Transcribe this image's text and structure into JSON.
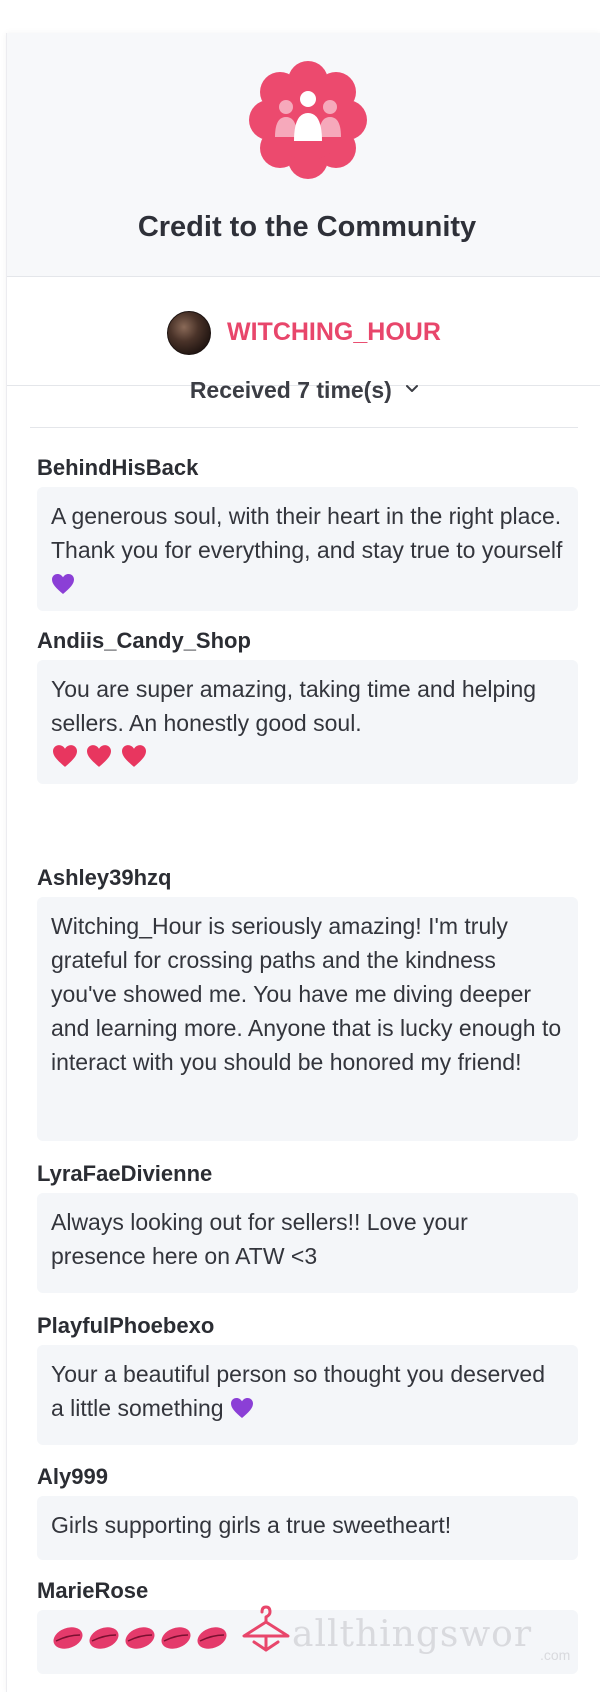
{
  "header": {
    "title": "Credit to the Community",
    "icon": "community-badge-icon",
    "accent_color": "#e8466b"
  },
  "recipient": {
    "username": "WITCHING_HOUR"
  },
  "received": {
    "label": "Received 7 time(s)"
  },
  "entries": [
    {
      "name": "BehindHisBack",
      "message": "A generous soul, with their heart in the right place. Thank you for everything, and stay true to yourself"
    },
    {
      "name": "Andiis_Candy_Shop",
      "message": "You are super amazing, taking time and helping sellers. An honestly good soul."
    },
    {
      "name": "Ashley39hzq",
      "message": "Witching_Hour is seriously amazing! I'm truly grateful for crossing paths and the kindness you've showed me. You have me diving deeper and learning more. Anyone that is lucky enough to interact with you should be honored my friend!"
    },
    {
      "name": "LyraFaeDivienne",
      "message": "Always looking out for sellers!! Love your presence here on ATW <3"
    },
    {
      "name": "PlayfulPhoebexo",
      "message": "Your a beautiful person so thought you deserved a little something"
    },
    {
      "name": "Aly999",
      "message": "Girls supporting girls a true sweetheart!"
    },
    {
      "name": "MarieRose",
      "message": ""
    }
  ],
  "watermark": {
    "text": "allthingswor",
    "suffix": ".com"
  }
}
